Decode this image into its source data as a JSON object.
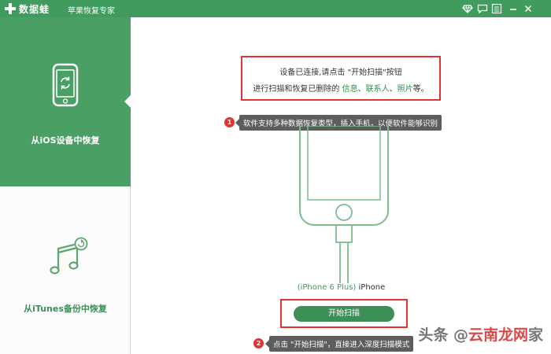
{
  "titlebar": {
    "brand": "数据蛙",
    "product": "苹果恢复专家",
    "icons": [
      "diamond-icon",
      "chat-icon",
      "menu-icon",
      "minimize-icon",
      "close-icon"
    ]
  },
  "sidebar": {
    "items": [
      {
        "label": "从iOS设备中恢复",
        "icon": "phone-sync-icon",
        "active": true
      },
      {
        "label": "从iTunes备份中恢复",
        "icon": "music-restore-icon",
        "active": false
      }
    ]
  },
  "main": {
    "notice": {
      "line1": "设备已连接,请点击 \"开始扫描\"按钮",
      "line2_prefix": "进行扫描和恢复已删除的 ",
      "line2_hl1": "信息",
      "line2_sep1": "、",
      "line2_hl2": "联系人",
      "line2_sep2": "、",
      "line2_hl3": "照片",
      "line2_suffix": "等。"
    },
    "tip1": {
      "badge": "1",
      "text": "软件支持多种数据恢复类型，插入手机，以便软件能够识别"
    },
    "device": {
      "model": "(iPhone 6 Plus)",
      "name": "iPhone"
    },
    "scan_button": "开始扫描",
    "tip2": {
      "badge": "2",
      "text": "点击 \"开始扫描\"，直接进入深度扫描模式"
    }
  },
  "watermark": {
    "prefix": "头条 @",
    "red": "云南龙网",
    "suffix": "家"
  },
  "colors": {
    "accent": "#4a9f65",
    "highlight": "#2f8f4e",
    "alert": "#e03434"
  }
}
